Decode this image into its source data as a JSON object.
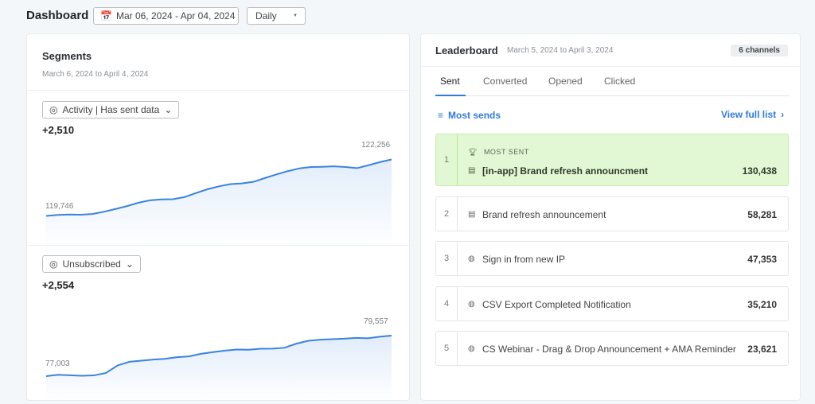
{
  "header": {
    "title": "Dashboard",
    "date_range": "Mar 06, 2024 - Apr 04, 2024",
    "interval": "Daily"
  },
  "segments": {
    "title": "Segments",
    "subtitle": "March 6, 2024 to April 4, 2024",
    "charts": [
      {
        "segment": "Activity | Has sent data",
        "change": "+2,510",
        "start_label": "119,746",
        "end_label": "122,256",
        "values": [
          119746,
          119790,
          119810,
          119800,
          119830,
          119930,
          120050,
          120180,
          120330,
          120440,
          120480,
          120490,
          120580,
          120760,
          120930,
          121060,
          121160,
          121190,
          121260,
          121430,
          121590,
          121740,
          121860,
          121920,
          121930,
          121950,
          121920,
          121870,
          122000,
          122140,
          122256
        ]
      },
      {
        "segment": "Unsubscribed",
        "change": "+2,554",
        "start_label": "77,003",
        "end_label": "79,557",
        "values": [
          77003,
          77090,
          77060,
          77030,
          77050,
          77200,
          77680,
          77910,
          77980,
          78050,
          78100,
          78200,
          78250,
          78410,
          78520,
          78610,
          78680,
          78670,
          78730,
          78740,
          78790,
          79050,
          79230,
          79300,
          79330,
          79360,
          79410,
          79390,
          79490,
          79557
        ]
      }
    ]
  },
  "leaderboard": {
    "title": "Leaderboard",
    "subtitle": "March 5, 2024 to April 3, 2024",
    "badge": "6 channels",
    "tabs": [
      "Sent",
      "Converted",
      "Opened",
      "Clicked"
    ],
    "sort_label": "Most sends",
    "view_full": "View full list",
    "top_label": "MOST SENT",
    "rows": [
      {
        "rank": "1",
        "name": "[in-app] Brand refresh announcment",
        "value": "130,438",
        "icon": "in-app-icon"
      },
      {
        "rank": "2",
        "name": "Brand refresh announcement",
        "value": "58,281",
        "icon": "in-app-icon"
      },
      {
        "rank": "3",
        "name": "Sign in from new IP",
        "value": "47,353",
        "icon": "click-icon"
      },
      {
        "rank": "4",
        "name": "CSV Export Completed Notification",
        "value": "35,210",
        "icon": "click-icon"
      },
      {
        "rank": "5",
        "name": "CS Webinar - Drag & Drop Announcement + AMA Reminder",
        "value": "23,621",
        "icon": "click-icon"
      }
    ]
  },
  "colors": {
    "accent": "#2f7bde",
    "highlight": "#e2f8d4",
    "line": "#3a83e0"
  }
}
